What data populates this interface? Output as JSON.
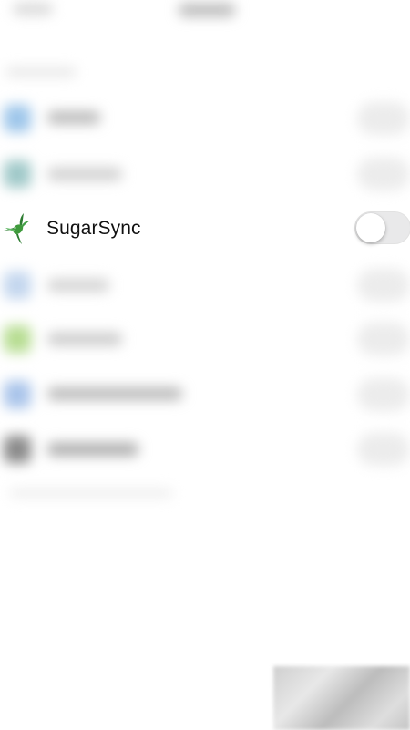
{
  "focused_row": {
    "app_name": "SugarSync",
    "toggle_on": false,
    "icon": "hummingbird-icon"
  },
  "colors": {
    "brand_green": "#3f9a3c",
    "toggle_off_track": "#e9e9ea"
  }
}
